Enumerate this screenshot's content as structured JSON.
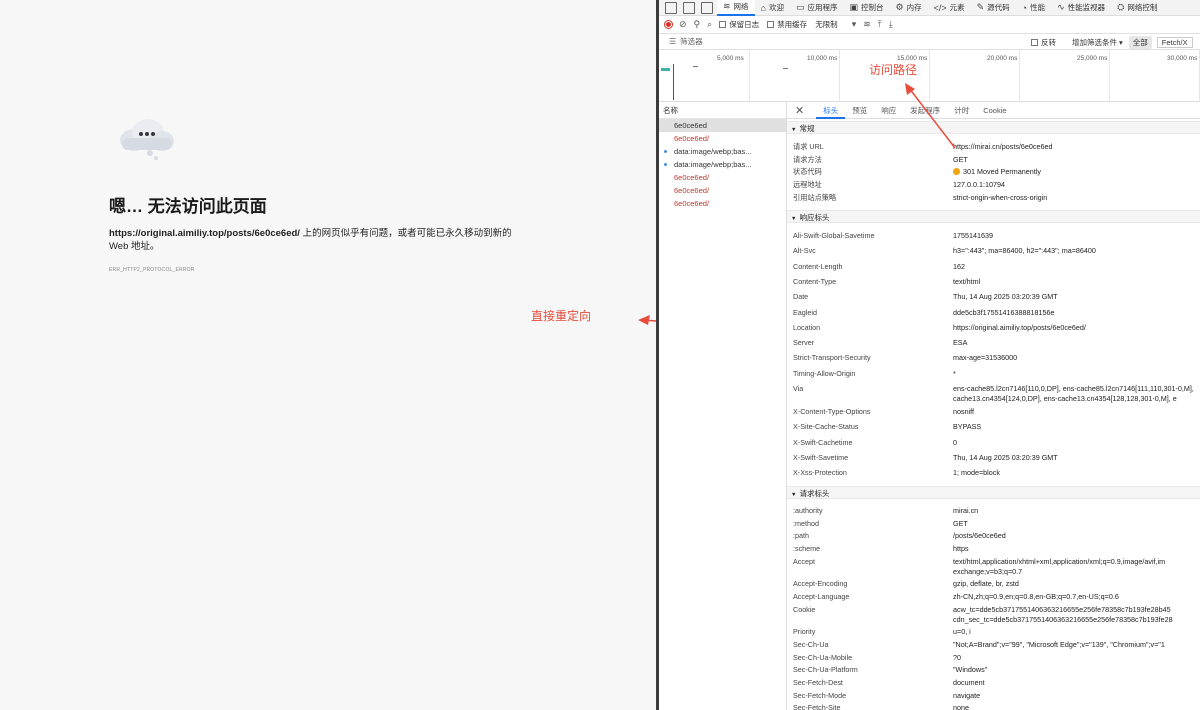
{
  "error_page": {
    "title": "嗯… 无法访问此页面",
    "url_bold": "https://original.aimiliy.top/posts/6e0ce6ed/",
    "desc_rest": " 上的网页似乎有问题，或者可能已永久移动到新的 Web 地址。",
    "error_code": "ERR_HTTP2_PROTOCOL_ERROR"
  },
  "annotations": {
    "redirect": "直接重定向",
    "path": "访问路径",
    "color": "#e74c3c"
  },
  "devtools": {
    "tabs": [
      {
        "icon": "wifi-icon",
        "glyph": "≋",
        "label": "网络",
        "active": true
      },
      {
        "icon": "home-icon",
        "glyph": "⌂",
        "label": "欢迎"
      },
      {
        "icon": "app-icon",
        "glyph": "▭",
        "label": "应用程序"
      },
      {
        "icon": "console-icon",
        "glyph": "▣",
        "label": "控制台"
      },
      {
        "icon": "memory-icon",
        "glyph": "⚙",
        "label": "内存"
      },
      {
        "icon": "elements-icon",
        "glyph": "</>",
        "label": "元素"
      },
      {
        "icon": "sources-icon",
        "glyph": "✎",
        "label": "源代码"
      },
      {
        "icon": "performance-icon",
        "glyph": "◔",
        "label": "性能"
      },
      {
        "icon": "perf-monitor-icon",
        "glyph": "∿",
        "label": "性能监视器"
      },
      {
        "icon": "network-console-icon",
        "glyph": "⛭",
        "label": "网络控制"
      }
    ],
    "toolbar": {
      "preserve_log": "保留日志",
      "disable_cache": "禁用缓存",
      "throttle": "无限制"
    },
    "filter": {
      "label": "筛选器",
      "invert": "反转",
      "more_filters": "增加筛选条件",
      "all": "全部",
      "fetch": "Fetch/X"
    },
    "timeline_ticks": [
      "5,000 ms",
      "10,000 ms",
      "15,000 ms",
      "20,000 ms",
      "25,000 ms",
      "30,000 ms"
    ],
    "req_list_header": "名称",
    "requests": [
      {
        "name": "6e0ce6ed",
        "style": "selected"
      },
      {
        "name": "6e0ce6ed/",
        "style": "red"
      },
      {
        "name": "data:image/webp;bas...",
        "style": "dark"
      },
      {
        "name": "data:image/webp;bas...",
        "style": "dark"
      },
      {
        "name": "6e0ce6ed/",
        "style": "red"
      },
      {
        "name": "6e0ce6ed/",
        "style": "red"
      },
      {
        "name": "6e0ce6ed/",
        "style": "red"
      }
    ],
    "detail_tabs": [
      "标头",
      "预览",
      "响应",
      "发起程序",
      "计时",
      "Cookie"
    ],
    "sections": {
      "general": "常规",
      "response": "响应标头",
      "request": "请求标头"
    },
    "general": [
      {
        "k": "请求 URL",
        "v": "https://mirai.cn/posts/6e0ce6ed"
      },
      {
        "k": "请求方法",
        "v": "GET"
      },
      {
        "k": "状态代码",
        "v": "301 Moved Permanently"
      },
      {
        "k": "远程地址",
        "v": "127.0.0.1:10794"
      },
      {
        "k": "引用站点策略",
        "v": "strict-origin-when-cross-origin"
      }
    ],
    "response_headers": [
      {
        "k": "Ali-Swift-Global-Savetime",
        "v": "1755141639"
      },
      {
        "k": "Alt-Svc",
        "v": "h3=\":443\"; ma=86400, h2=\":443\"; ma=86400"
      },
      {
        "k": "Content-Length",
        "v": "162"
      },
      {
        "k": "Content-Type",
        "v": "text/html"
      },
      {
        "k": "Date",
        "v": "Thu, 14 Aug 2025 03:20:39 GMT"
      },
      {
        "k": "Eagleid",
        "v": "dde5cb3f17551416388818156e"
      },
      {
        "k": "Location",
        "v": "https://original.aimiliy.top/posts/6e0ce6ed/"
      },
      {
        "k": "Server",
        "v": "ESA"
      },
      {
        "k": "Strict-Transport-Security",
        "v": "max-age=31536000"
      },
      {
        "k": "Timing-Allow-Origin",
        "v": "*"
      },
      {
        "k": "Via",
        "v": "ens-cache85.l2cn7146[110,0,DP], ens-cache85.l2cn7146[111,110,301-0,M],",
        "v2": "cache13.cn4354[124,0,DP], ens-cache13.cn4354[128,128,301-0,M], e"
      },
      {
        "k": "X-Content-Type-Options",
        "v": "nosniff"
      },
      {
        "k": "X-Site-Cache-Status",
        "v": "BYPASS"
      },
      {
        "k": "X-Swift-Cachetime",
        "v": "0"
      },
      {
        "k": "X-Swift-Savetime",
        "v": "Thu, 14 Aug 2025 03:20:39 GMT"
      },
      {
        "k": "X-Xss-Protection",
        "v": "1; mode=block"
      }
    ],
    "request_headers": [
      {
        "k": ":authority",
        "v": "mirai.cn"
      },
      {
        "k": ":method",
        "v": "GET"
      },
      {
        "k": ":path",
        "v": "/posts/6e0ce6ed"
      },
      {
        "k": ":scheme",
        "v": "https"
      },
      {
        "k": "Accept",
        "v": "text/html,application/xhtml+xml,application/xml;q=0.9,image/avif,im",
        "v2": "exchange;v=b3;q=0.7"
      },
      {
        "k": "Accept-Encoding",
        "v": "gzip, deflate, br, zstd"
      },
      {
        "k": "Accept-Language",
        "v": "zh-CN,zh;q=0.9,en;q=0.8,en-GB;q=0.7,en-US;q=0.6"
      },
      {
        "k": "Cookie",
        "v": "acw_tc=dde5cb3717551406363216655e256fe78358c7b193fe28b45",
        "v2": "cdn_sec_tc=dde5cb3717551406363216655e256fe78358c7b193fe28"
      },
      {
        "k": "Priority",
        "v": "u=0, i"
      },
      {
        "k": "Sec-Ch-Ua",
        "v": "\"Not;A=Brand\";v=\"99\", \"Microsoft Edge\";v=\"139\", \"Chromium\";v=\"1"
      },
      {
        "k": "Sec-Ch-Ua-Mobile",
        "v": "?0"
      },
      {
        "k": "Sec-Ch-Ua-Platform",
        "v": "\"Windows\""
      },
      {
        "k": "Sec-Fetch-Dest",
        "v": "document"
      },
      {
        "k": "Sec-Fetch-Mode",
        "v": "navigate"
      },
      {
        "k": "Sec-Fetch-Site",
        "v": "none"
      }
    ]
  }
}
